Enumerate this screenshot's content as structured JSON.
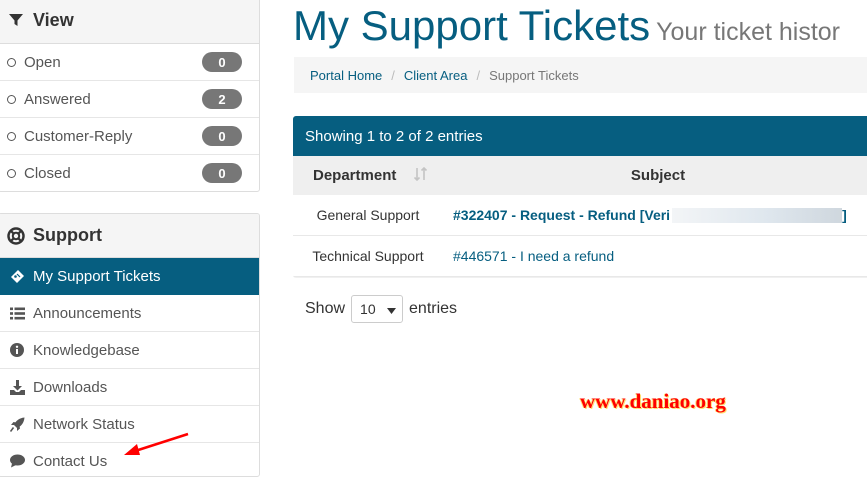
{
  "sidebar": {
    "view": {
      "title": "View",
      "filters": [
        {
          "label": "Open",
          "count": "0"
        },
        {
          "label": "Answered",
          "count": "2"
        },
        {
          "label": "Customer-Reply",
          "count": "0"
        },
        {
          "label": "Closed",
          "count": "0"
        }
      ]
    },
    "support": {
      "title": "Support",
      "items": [
        {
          "label": "My Support Tickets",
          "icon": "ticket-icon",
          "active": true
        },
        {
          "label": "Announcements",
          "icon": "list-icon"
        },
        {
          "label": "Knowledgebase",
          "icon": "info-circle-icon"
        },
        {
          "label": "Downloads",
          "icon": "download-icon"
        },
        {
          "label": "Network Status",
          "icon": "rocket-icon"
        },
        {
          "label": "Contact Us",
          "icon": "comment-icon"
        }
      ]
    }
  },
  "main": {
    "title": "My Support Tickets",
    "subtitle": "Your ticket histor",
    "breadcrumb": [
      "Portal Home",
      "Client Area",
      "Support Tickets"
    ],
    "table": {
      "info": "Showing 1 to 2 of 2 entries",
      "headers": [
        "Department",
        "Subject"
      ],
      "rows": [
        {
          "department": "General Support",
          "subject": "#322407 - Request - Refund [Veri",
          "subject_tail": "]"
        },
        {
          "department": "Technical Support",
          "subject": "#446571 - I need a refund"
        }
      ]
    },
    "length": {
      "show": "Show",
      "value": "10",
      "entries": "entries"
    }
  },
  "watermark": "www.daniao.org",
  "colors": {
    "accent": "#065e80",
    "badge": "#777777",
    "annotation": "#ff0000"
  }
}
